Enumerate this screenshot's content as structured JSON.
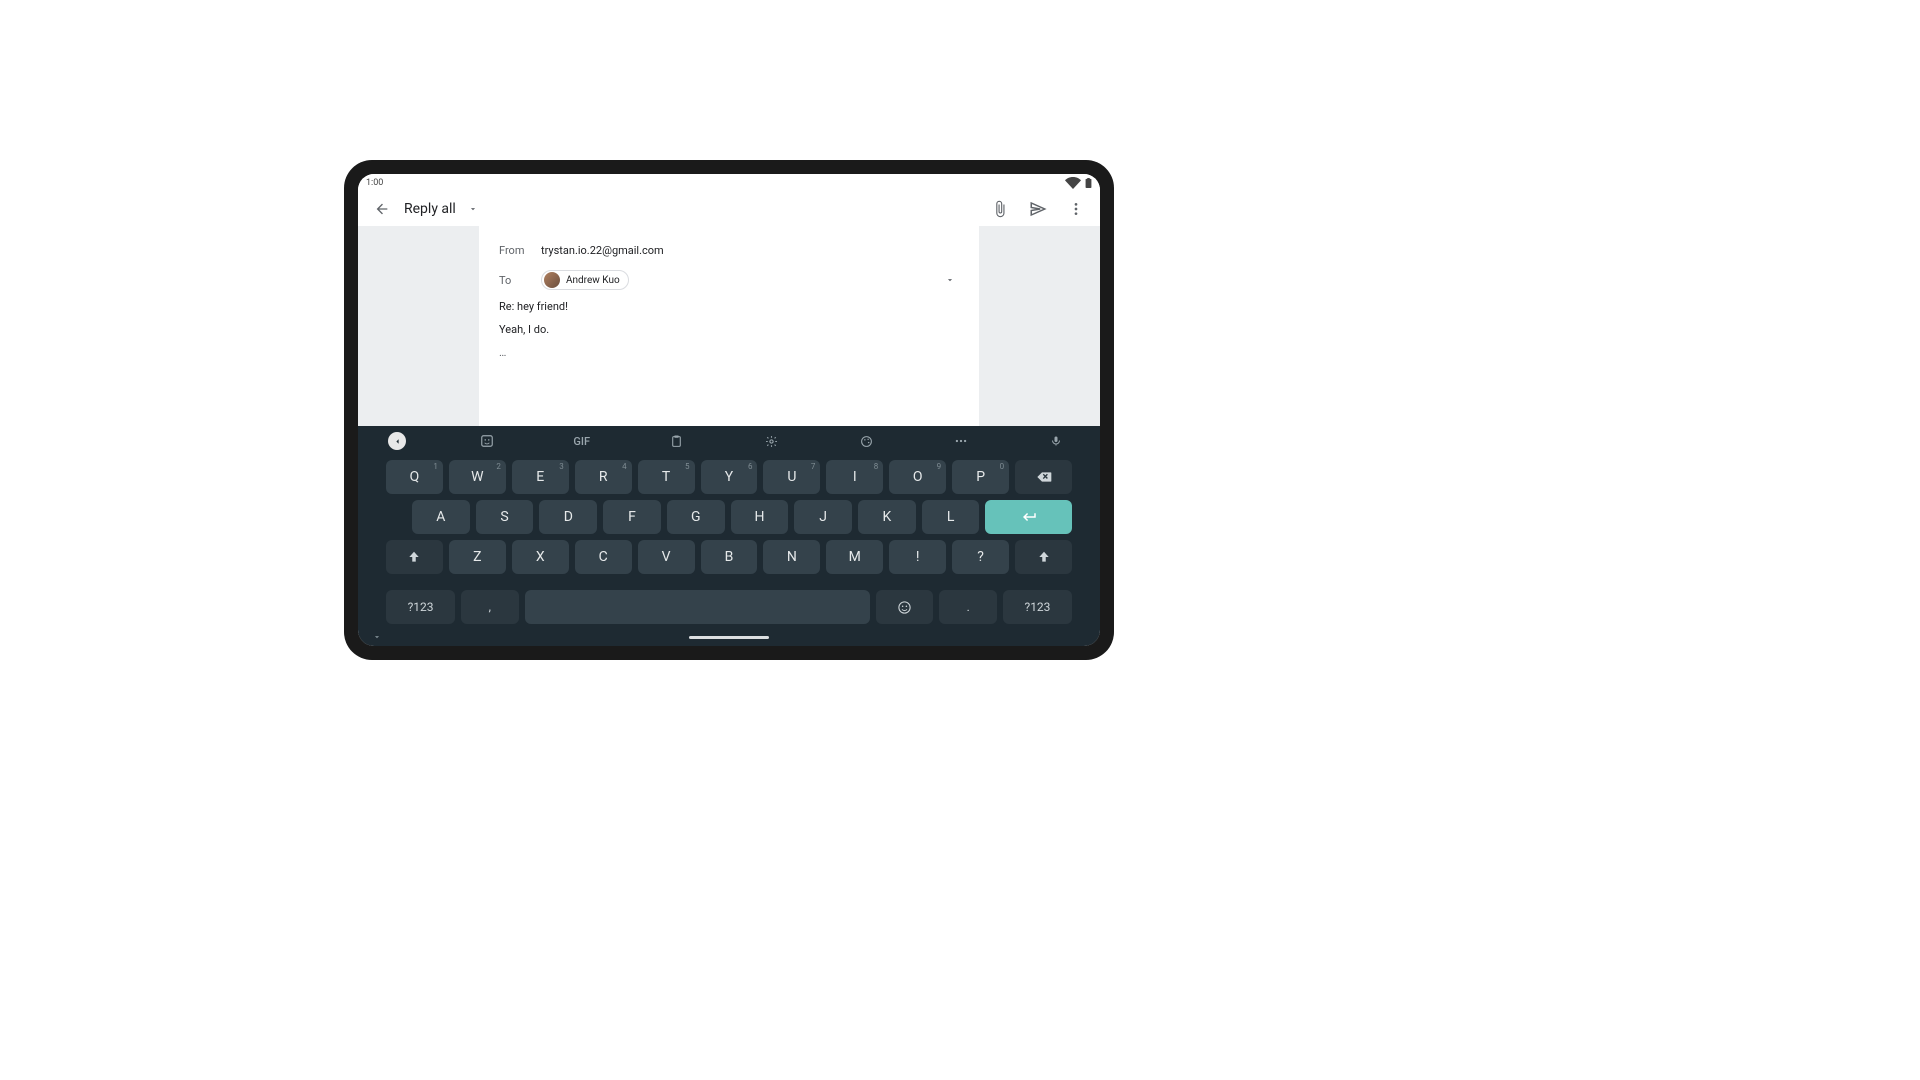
{
  "status": {
    "time": "1:00"
  },
  "appbar": {
    "title": "Reply all"
  },
  "compose": {
    "from_label": "From",
    "from_value": "trystan.io.22@gmail.com",
    "to_label": "To",
    "to_chip_name": "Andrew Kuo",
    "subject": "Re: hey friend!",
    "body": "Yeah, I do.",
    "ellipsis": "…"
  },
  "keyboard": {
    "gif_label": "GIF",
    "row1": [
      {
        "k": "Q",
        "n": "1"
      },
      {
        "k": "W",
        "n": "2"
      },
      {
        "k": "E",
        "n": "3"
      },
      {
        "k": "R",
        "n": "4"
      },
      {
        "k": "T",
        "n": "5"
      },
      {
        "k": "Y",
        "n": "6"
      },
      {
        "k": "U",
        "n": "7"
      },
      {
        "k": "I",
        "n": "8"
      },
      {
        "k": "O",
        "n": "9"
      },
      {
        "k": "P",
        "n": "0"
      }
    ],
    "row2": [
      "A",
      "S",
      "D",
      "F",
      "G",
      "H",
      "J",
      "K",
      "L"
    ],
    "row3": [
      "Z",
      "X",
      "C",
      "V",
      "B",
      "N",
      "M",
      "!",
      "?"
    ],
    "numkey": "?123",
    "comma": ",",
    "period": "."
  }
}
